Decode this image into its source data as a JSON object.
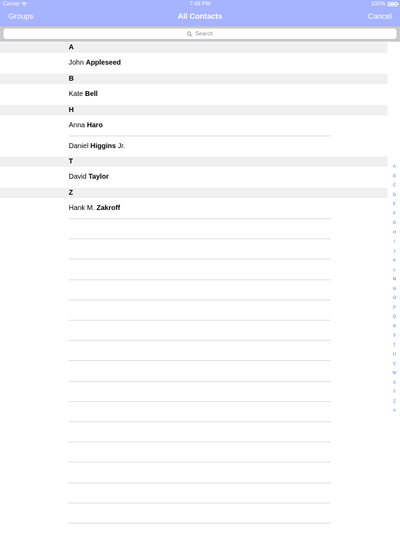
{
  "status": {
    "carrier": "Carrier",
    "time": "7:49 PM",
    "battery": "100%"
  },
  "nav": {
    "left": "Groups",
    "title": "All Contacts",
    "right": "Cancel"
  },
  "search": {
    "placeholder": "Search"
  },
  "sections": [
    {
      "letter": "A",
      "contacts": [
        {
          "first": "John",
          "last": "Appleseed",
          "suffix": ""
        }
      ]
    },
    {
      "letter": "B",
      "contacts": [
        {
          "first": "Kate",
          "last": "Bell",
          "suffix": ""
        }
      ]
    },
    {
      "letter": "H",
      "contacts": [
        {
          "first": "Anna",
          "last": "Haro",
          "suffix": ""
        },
        {
          "first": "Daniel",
          "last": "Higgins",
          "suffix": "Jr."
        }
      ]
    },
    {
      "letter": "T",
      "contacts": [
        {
          "first": "David",
          "last": "Taylor",
          "suffix": ""
        }
      ]
    },
    {
      "letter": "Z",
      "contacts": [
        {
          "first": "Hank M.",
          "last": "Zakroff",
          "suffix": ""
        }
      ]
    }
  ],
  "index": [
    "A",
    "B",
    "C",
    "D",
    "E",
    "F",
    "G",
    "H",
    "I",
    "J",
    "K",
    "L",
    "M",
    "N",
    "O",
    "P",
    "Q",
    "R",
    "S",
    "T",
    "U",
    "V",
    "W",
    "X",
    "Y",
    "Z",
    "#"
  ],
  "colors": {
    "nav_bg": "#a6b3ff",
    "index_blue": "#3d7cf5",
    "section_bg": "#f0f0f0"
  }
}
